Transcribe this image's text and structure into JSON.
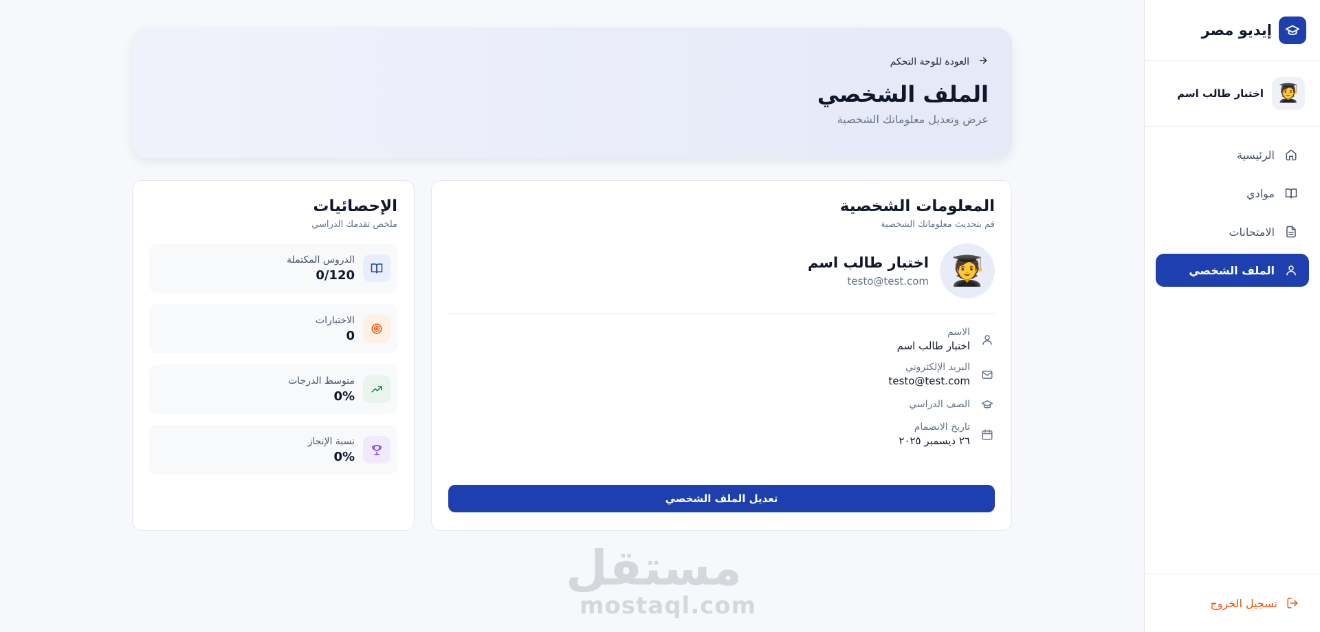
{
  "brand": {
    "name": "إيديو مصر",
    "icon": "graduation-cap-icon",
    "color": "#1e40af"
  },
  "user": {
    "name": "اختبار طالب اسم",
    "avatar": "🧑‍🎓"
  },
  "nav": [
    {
      "label": "الرئيسية",
      "icon": "home-icon",
      "active": false
    },
    {
      "label": "موادي",
      "icon": "book-icon",
      "active": false
    },
    {
      "label": "الامتحانات",
      "icon": "file-icon",
      "active": false
    },
    {
      "label": "الملف الشخصي",
      "icon": "user-icon",
      "active": true
    }
  ],
  "logout": {
    "label": "تسجيل الخروج",
    "color": "#ea580c"
  },
  "header": {
    "back_label": "العودة للوحة التحكم",
    "title": "الملف الشخصي",
    "subtitle": "عرض وتعديل معلوماتك الشخصية"
  },
  "info": {
    "title": "المعلومات الشخصية",
    "subtitle": "قم بتحديث معلوماتك الشخصية",
    "profile_name": "اختبار طالب اسم",
    "profile_email": "testo@test.com",
    "fields": [
      {
        "label": "الاسم",
        "value": "اختبار طالب اسم",
        "icon": "user-icon"
      },
      {
        "label": "البريد الإلكتروني",
        "value": "testo@test.com",
        "icon": "mail-icon"
      },
      {
        "label": "الصف الدراسي",
        "value": "",
        "icon": "graduation-cap-icon"
      },
      {
        "label": "تاريخ الانضمام",
        "value": "٢٦ ديسمبر ٢٠٢٥",
        "icon": "calendar-icon"
      }
    ],
    "edit_button": "تعديل الملف الشخصي"
  },
  "stats": {
    "title": "الإحصائيات",
    "subtitle": "ملخص تقدمك الدراسي",
    "items": [
      {
        "label": "الدروس المكتملة",
        "value": "0/120",
        "icon": "book-open-icon",
        "color": "#1e40af",
        "bg": "#e8eefb"
      },
      {
        "label": "الاختبارات",
        "value": "0",
        "icon": "target-icon",
        "color": "#ea580c",
        "bg": "#fdf1e4"
      },
      {
        "label": "متوسط الدرجات",
        "value": "0%",
        "icon": "trending-up-icon",
        "color": "#15803d",
        "bg": "#e8f5ec"
      },
      {
        "label": "نسبة الإنجاز",
        "value": "0%",
        "icon": "trophy-icon",
        "color": "#7c3aed",
        "bg": "#f1e9fc"
      }
    ]
  },
  "watermark": {
    "arabic": "مستقل",
    "latin": "mostaql.com"
  }
}
